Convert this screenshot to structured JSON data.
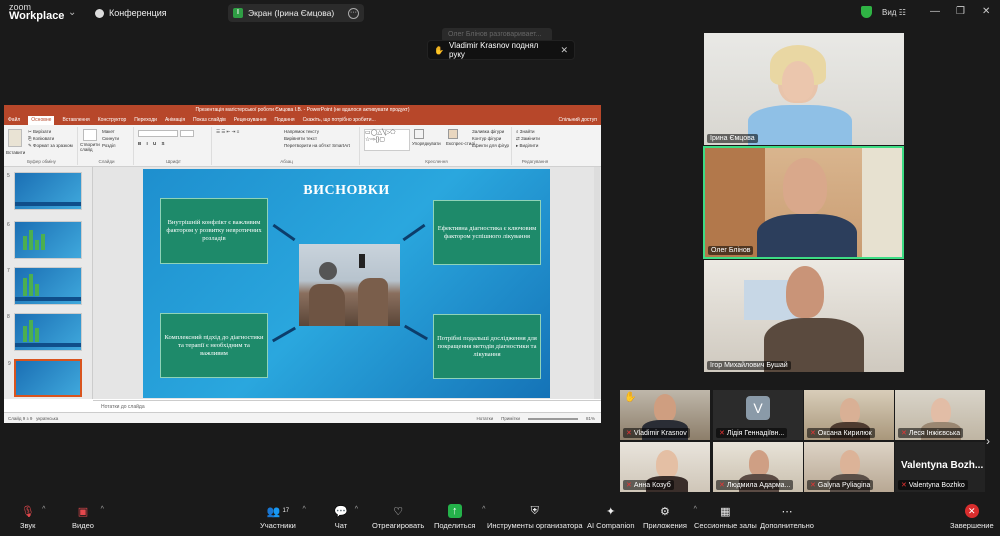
{
  "topbar": {
    "logo_top": "zoom",
    "logo_bottom": "Workplace",
    "meeting_label": "Конференция",
    "share_label": "Экран (Ірина Ємцова)",
    "view_label": "Вид",
    "tooltip": "Олег Блінов разговаривает...",
    "raise_hand_toast": "Vladimir Krasnov поднял руку"
  },
  "ppt": {
    "window_title": "Презентація магістерської роботи Ємцова І.В. - PowerPoint (не вдалося активувати продукт)",
    "tabs": [
      "Файл",
      "Основне",
      "Вставлення",
      "Конструктор",
      "Переходи",
      "Анімація",
      "Показ слайдів",
      "Рецензування",
      "Подання"
    ],
    "search_hint": "Скажіть, що потрібно зробити...",
    "share_btn": "Спільний доступ",
    "ribbon": {
      "paste": "Вставити",
      "cut": "Вирізати",
      "copy": "Копіювати",
      "format_painter": "Формат за зразком",
      "clipboard": "Буфер обміну",
      "new_slide": "Створити слайд",
      "layout": "Макет",
      "reset": "Скинути",
      "section": "Розділ",
      "slides": "Слайди",
      "font": "Шрифт",
      "text_dir": "Напрямок тексту",
      "align_text": "Вирівняти текст",
      "smartart": "Перетворити на об'єкт SmartArt",
      "paragraph": "Абзац",
      "arrange": "Упорядкувати",
      "quick_styles": "Експрес-стилі",
      "shape_fill": "Заливка фігури",
      "shape_outline": "Контур фігури",
      "shape_effects": "Ефекти для фігур",
      "drawing": "Креслення",
      "find": "Знайти",
      "replace": "Замінити",
      "select": "Виділити",
      "editing": "Редагування"
    },
    "thumb_numbers": [
      "5",
      "6",
      "7",
      "8",
      "9"
    ],
    "slide": {
      "title": "ВИСНОВКИ",
      "box_tl": "Внутрішній конфлікт є важливим фактором у розвитку невротичних розладів",
      "box_tr": "Ефективна діагностика є ключовим фактором успішного лікування",
      "box_bl": "Комплексний підхід до діагностики та терапії є необхідним та важливим",
      "box_br": "Потрібні подальші дослідження для покращення методів діагностики та лікування"
    },
    "notes": "Нотатки до слайда",
    "status_left": "Слайд 9 з 9",
    "status_lang": "українська",
    "status_notes": "Нотатки",
    "status_comments": "Примітки",
    "zoom": "81%"
  },
  "participants": {
    "big": [
      {
        "name": "Ірина Ємцова"
      },
      {
        "name": "Олег Блінов"
      },
      {
        "name": "Ігор Михайлович Бушай"
      }
    ],
    "small": [
      {
        "name": "Vladimir Krasnov"
      },
      {
        "name": "Лідія Геннадіївн...",
        "initial": "V"
      },
      {
        "name": "Оксана Кирилюк"
      },
      {
        "name": "Леся Інжієвська"
      },
      {
        "name": "Анна Козуб"
      },
      {
        "name": "Людмила Адарма..."
      },
      {
        "name": "Galyna Pyliagina"
      },
      {
        "name": "Valentyna Bozhko",
        "display": "Valentyna  Bozh..."
      }
    ]
  },
  "toolbar": {
    "mute": "Звук",
    "video": "Видео",
    "participants": "Участники",
    "participants_count": "17",
    "chat": "Чат",
    "react": "Отреагировать",
    "share": "Поделиться",
    "host_tools": "Инструменты организатора",
    "ai": "AI Companion",
    "apps": "Приложения",
    "breakout": "Сессионные залы",
    "more": "Дополнительно",
    "end": "Завершение"
  }
}
